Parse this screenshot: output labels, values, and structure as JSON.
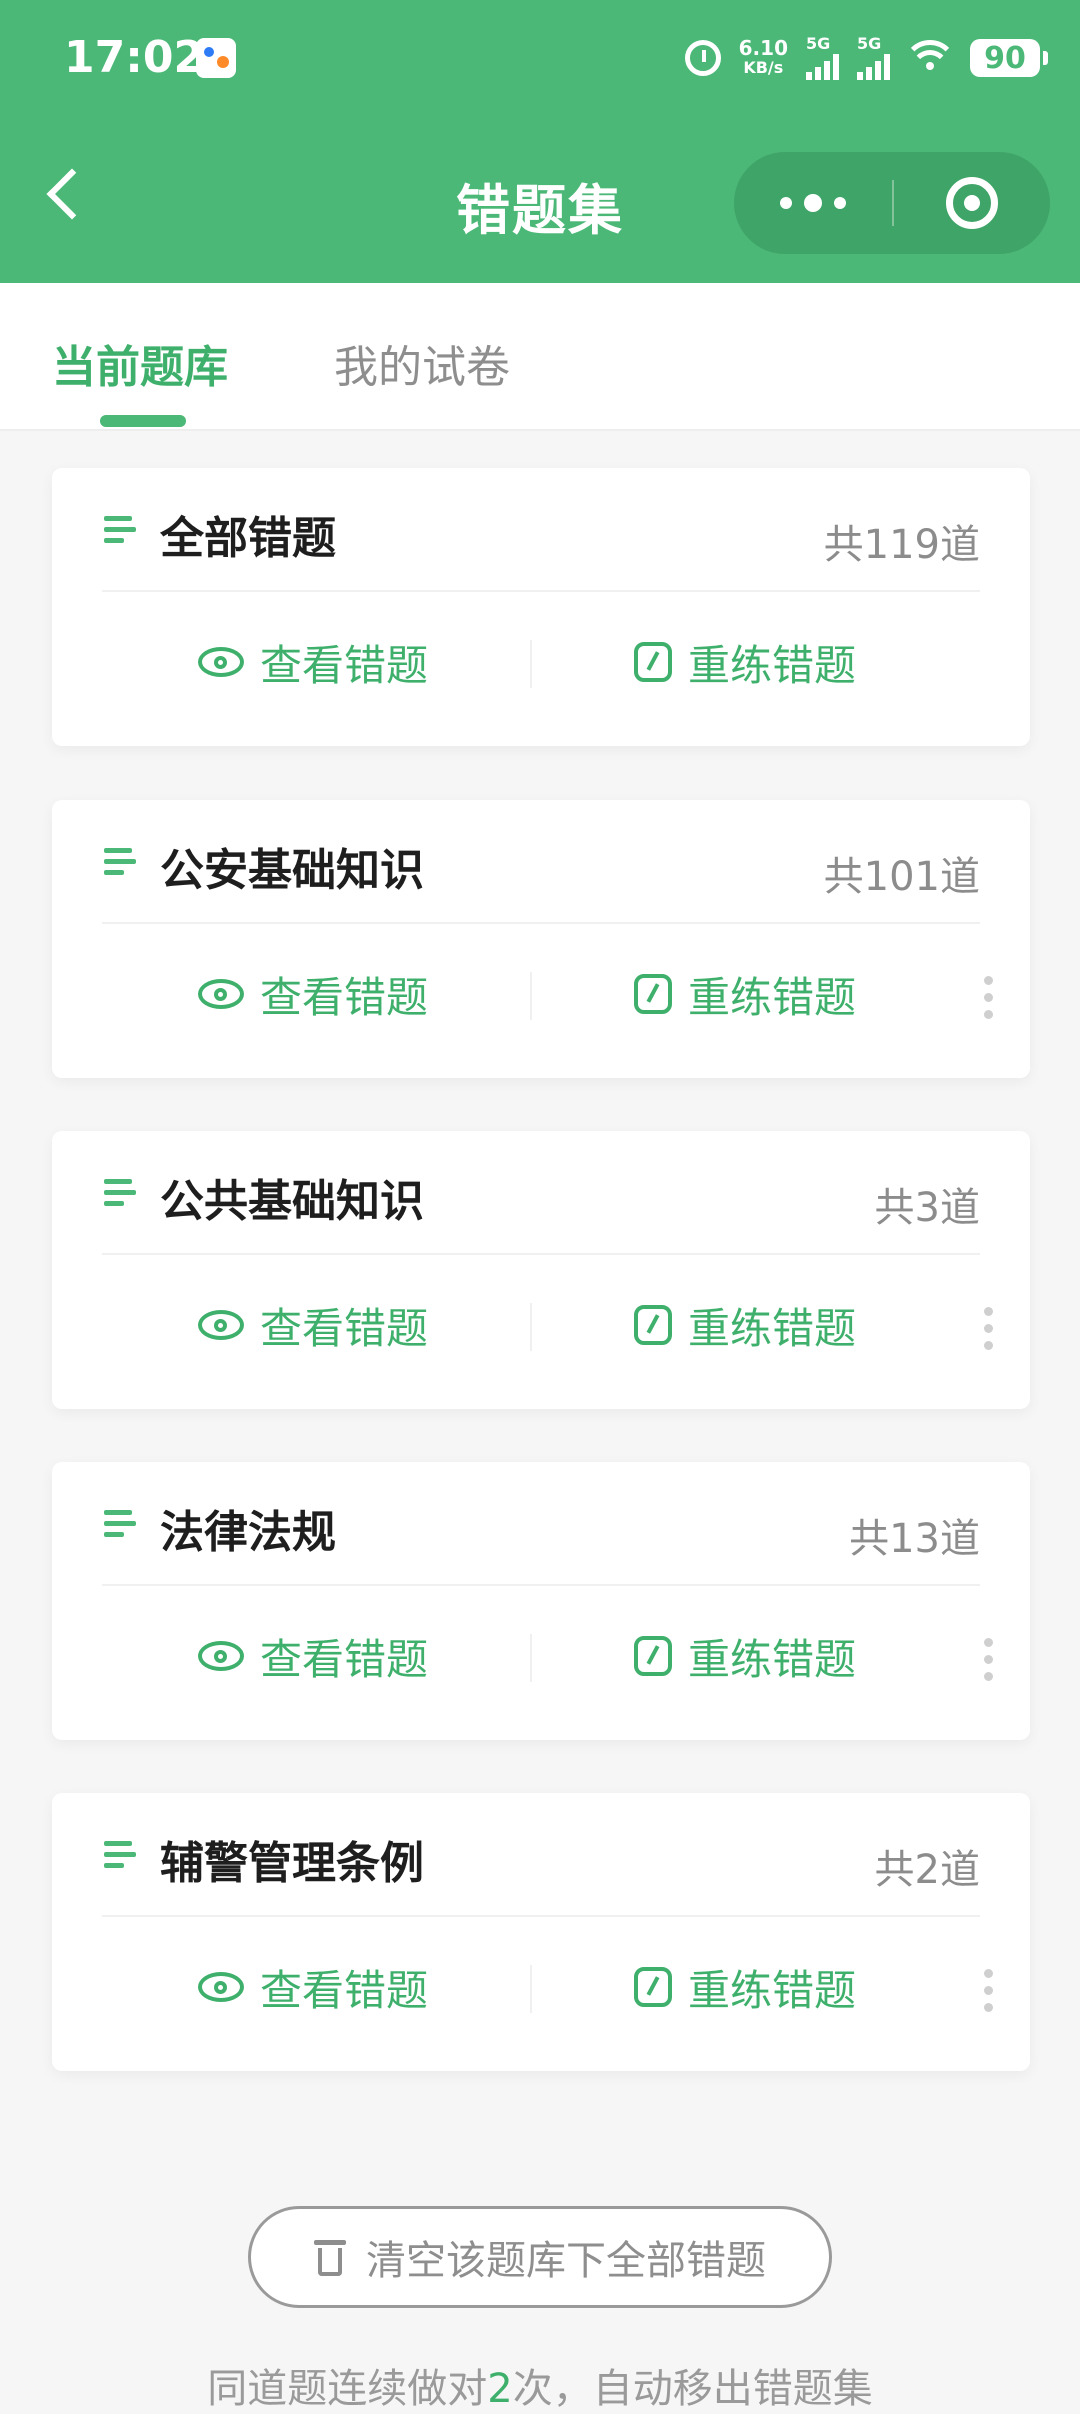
{
  "status_bar": {
    "time": "17:02",
    "net_speed_value": "6.10",
    "net_speed_unit": "KB/s",
    "sim1_label": "5G",
    "sim2_label": "5G",
    "battery": "90"
  },
  "nav": {
    "title": "错题集"
  },
  "tabs": [
    {
      "label": "当前题库",
      "active": true
    },
    {
      "label": "我的试卷",
      "active": false
    }
  ],
  "cards": [
    {
      "title": "全部错题",
      "count": "共119道",
      "view_label": "查看错题",
      "redo_label": "重练错题",
      "has_menu": false
    },
    {
      "title": "公安基础知识",
      "count": "共101道",
      "view_label": "查看错题",
      "redo_label": "重练错题",
      "has_menu": true
    },
    {
      "title": "公共基础知识",
      "count": "共3道",
      "view_label": "查看错题",
      "redo_label": "重练错题",
      "has_menu": true
    },
    {
      "title": "法律法规",
      "count": "共13道",
      "view_label": "查看错题",
      "redo_label": "重练错题",
      "has_menu": true
    },
    {
      "title": "辅警管理条例",
      "count": "共2道",
      "view_label": "查看错题",
      "redo_label": "重练错题",
      "has_menu": true
    }
  ],
  "footer": {
    "clear_button_label": "清空该题库下全部错题",
    "hint_prefix": "同道题连续做对",
    "hint_number": "2",
    "hint_suffix": "次，自动移出错题集"
  },
  "colors": {
    "brand_green": "#4bb877",
    "text_green": "#3fb06c"
  }
}
